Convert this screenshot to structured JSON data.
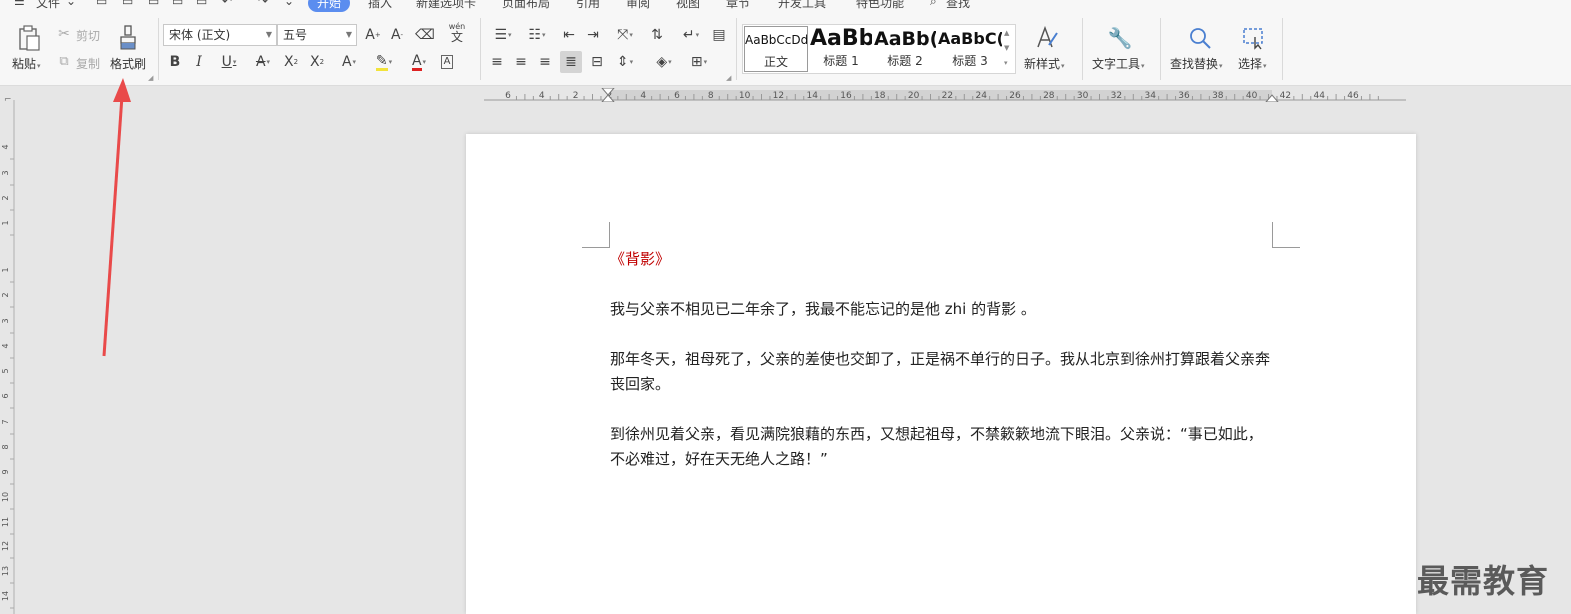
{
  "tabs": {
    "file": "文件",
    "start": "开始",
    "insert": "插入",
    "new_tab": "新建选项卡",
    "layout": "页面布局",
    "ref": "引用",
    "review": "审阅",
    "view": "视图",
    "chapter": "章节",
    "dev": "开发工具",
    "special": "特色功能",
    "search": "查找"
  },
  "ribbon": {
    "paste": "粘贴",
    "cut": "剪切",
    "copy": "复制",
    "format_painter": "格式刷",
    "font_name": "宋体 (正文)",
    "font_size": "五号",
    "pinyin": "wén",
    "styles": [
      {
        "preview": "AaBbCcDd",
        "name": "正文"
      },
      {
        "preview": "AaBb",
        "name": "标题 1"
      },
      {
        "preview": "AaBb(",
        "name": "标题 2"
      },
      {
        "preview": "AaBbC(",
        "name": "标题 3"
      }
    ],
    "new_style": "新样式",
    "text_tools": "文字工具",
    "find_replace": "查找替换",
    "select": "选择"
  },
  "ruler": {
    "h_labels": [
      "6",
      "4",
      "2",
      "2",
      "4",
      "6",
      "8",
      "10",
      "12",
      "14",
      "16",
      "18",
      "20",
      "22",
      "24",
      "26",
      "28",
      "30",
      "32",
      "34",
      "36",
      "38",
      "40",
      "42",
      "44",
      "46"
    ],
    "v_labels": [
      "4",
      "3",
      "2",
      "1",
      "1",
      "2",
      "3",
      "4",
      "5",
      "6",
      "7",
      "8",
      "9",
      "10",
      "11",
      "12",
      "13",
      "14"
    ]
  },
  "document": {
    "title": "《背影》",
    "paragraphs": [
      "我与父亲不相见已二年余了，我最不能忘记的是他 zhi 的背影 。",
      "那年冬天，祖母死了，父亲的差使也交卸了，正是祸不单行的日子。我从北京到徐州打算跟着父亲奔丧回家。",
      "到徐州见着父亲，看见满院狼藉的东西，又想起祖母，不禁簌簌地流下眼泪。父亲说：“事已如此，不必难过，好在天无绝人之路！”"
    ]
  },
  "watermark": "最需教育",
  "colors": {
    "accent": "#5b8def",
    "title_red": "#c00000",
    "annotation_arrow": "#e94a4a"
  }
}
